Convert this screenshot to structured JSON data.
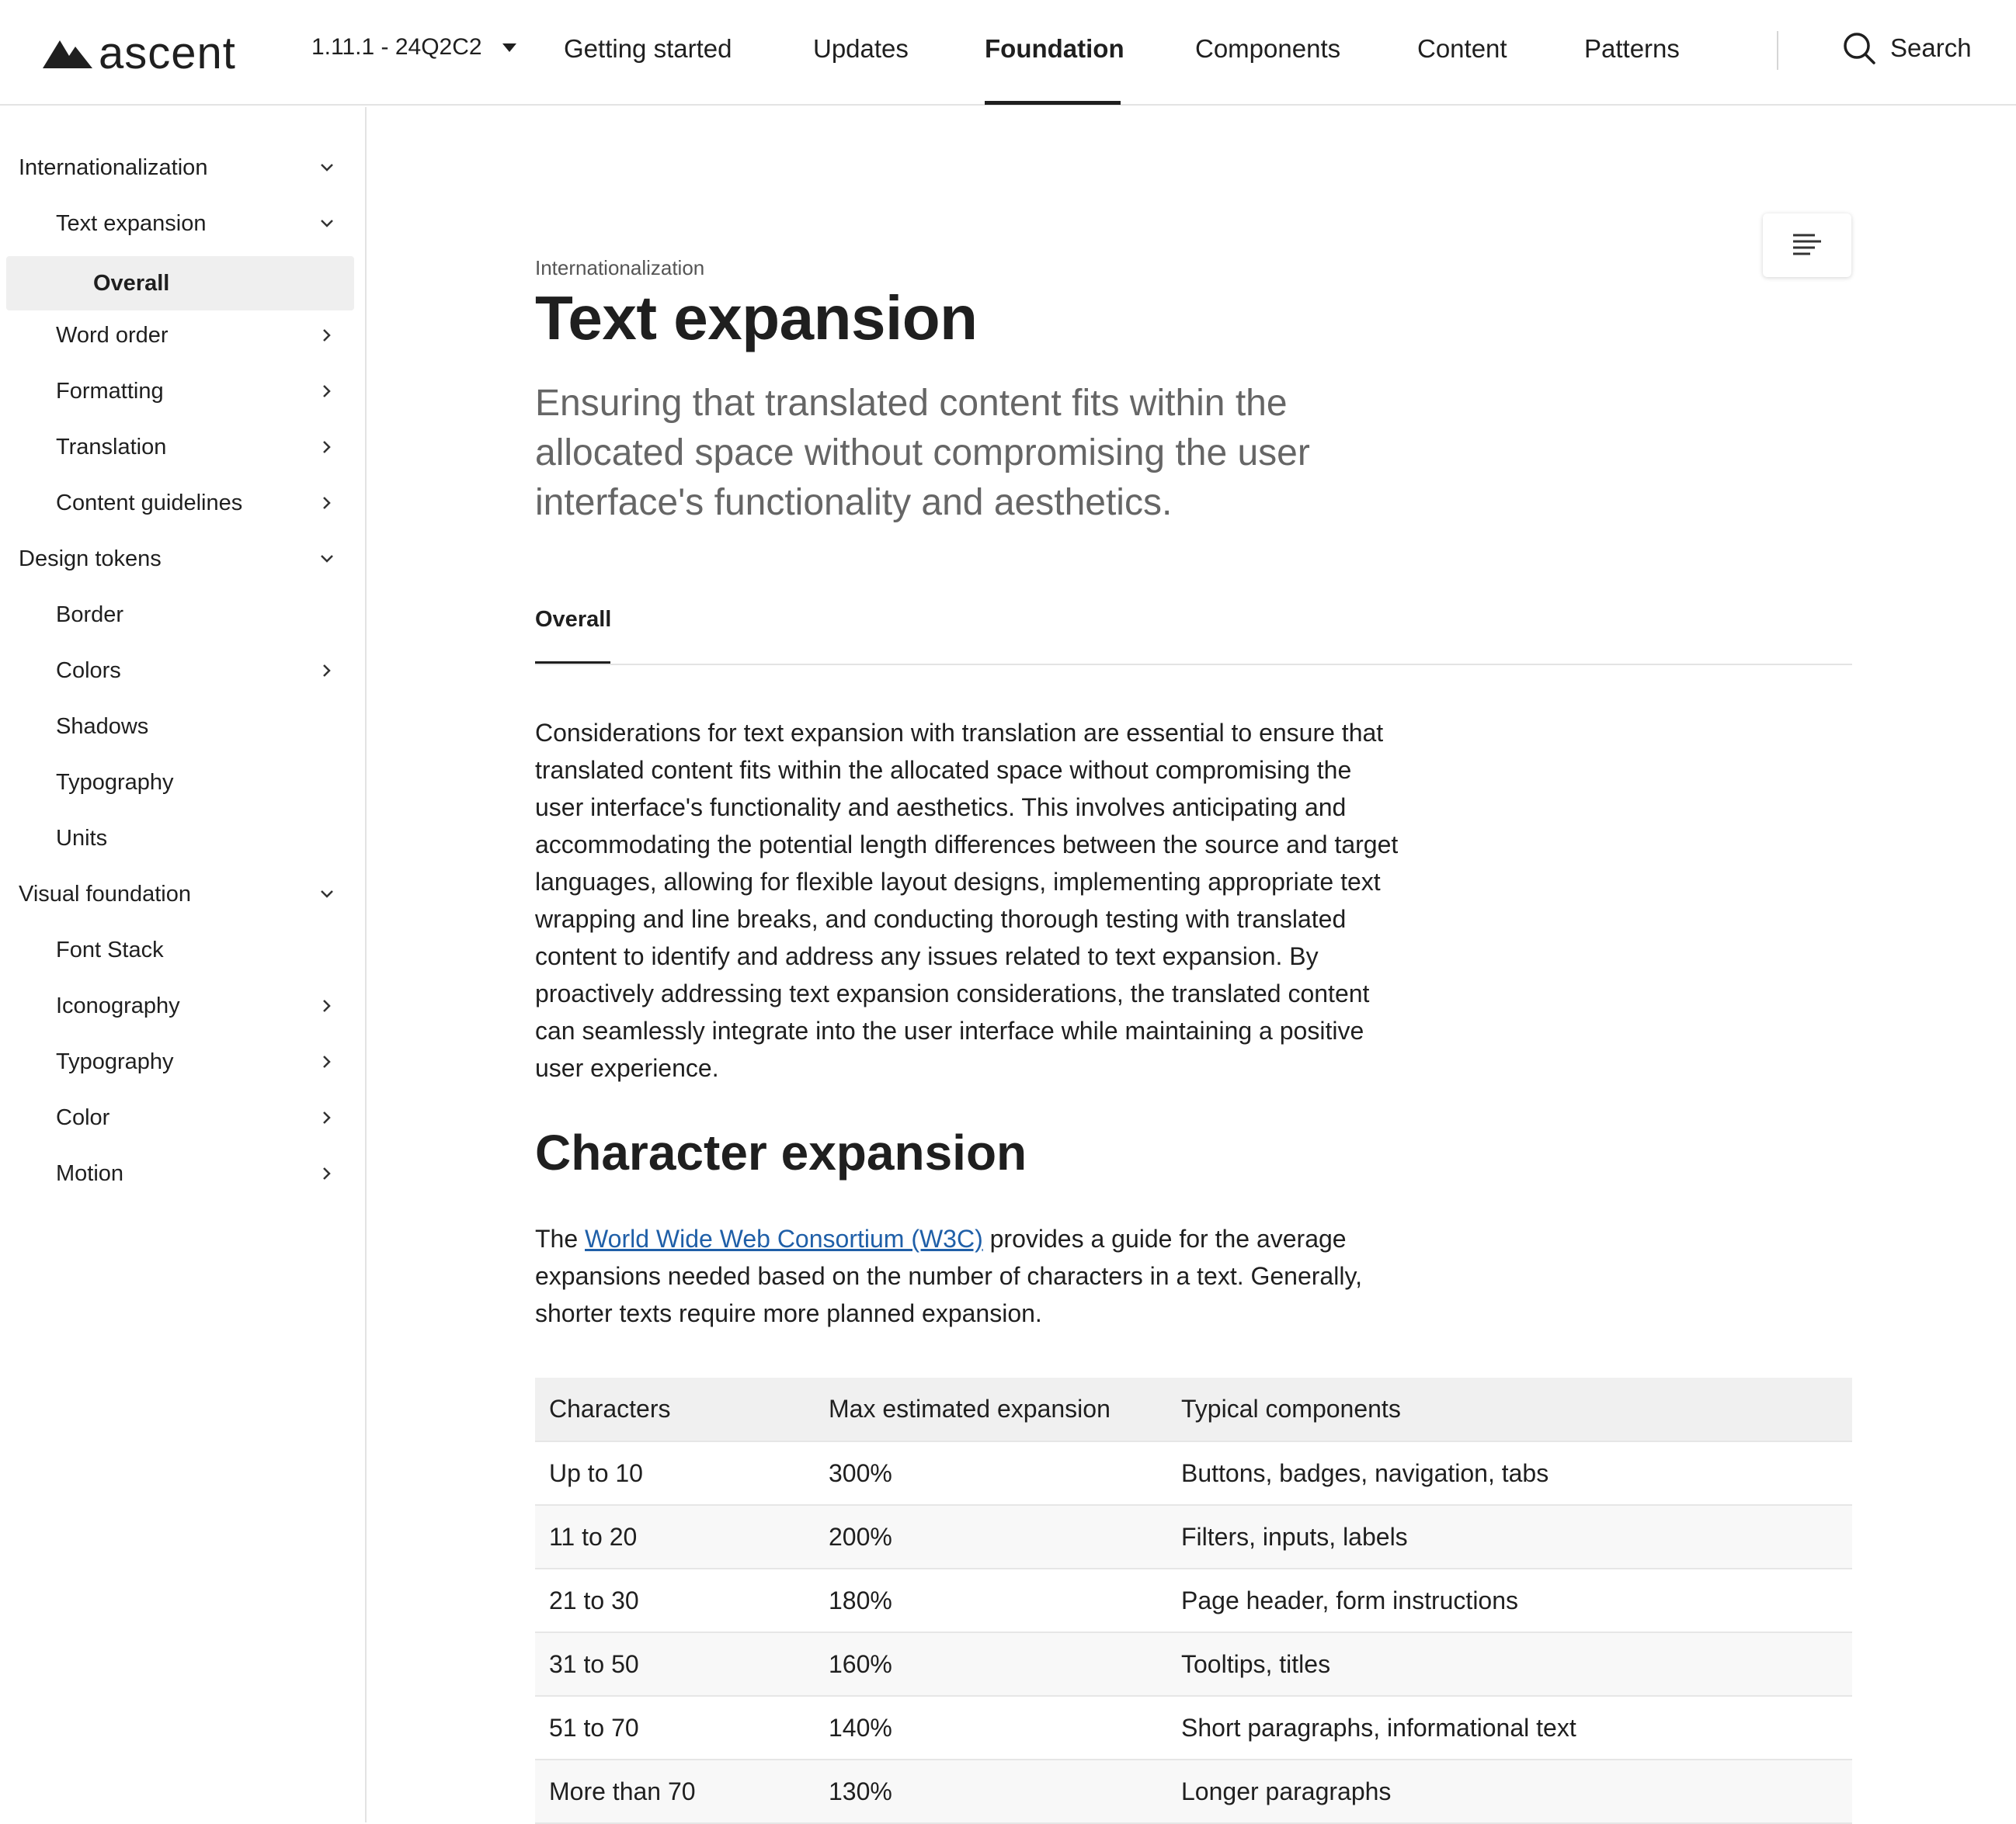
{
  "header": {
    "brand": "ascent",
    "version": "1.11.1 - 24Q2C2",
    "nav": [
      {
        "label": "Getting started",
        "active": false
      },
      {
        "label": "Updates",
        "active": false
      },
      {
        "label": "Foundation",
        "active": true
      },
      {
        "label": "Components",
        "active": false
      },
      {
        "label": "Content",
        "active": false
      },
      {
        "label": "Patterns",
        "active": false
      }
    ],
    "search_label": "Search"
  },
  "sidebar": {
    "items": [
      {
        "label": "Internationalization",
        "level": 1,
        "chevron": "down"
      },
      {
        "label": "Text expansion",
        "level": 2,
        "chevron": "down"
      },
      {
        "label": "Overall",
        "level": 3,
        "chevron": "none",
        "selected": true
      },
      {
        "label": "Word order",
        "level": 2,
        "chevron": "right"
      },
      {
        "label": "Formatting",
        "level": 2,
        "chevron": "right"
      },
      {
        "label": "Translation",
        "level": 2,
        "chevron": "right"
      },
      {
        "label": "Content guidelines",
        "level": 2,
        "chevron": "right"
      },
      {
        "label": "Design tokens",
        "level": 1,
        "chevron": "down"
      },
      {
        "label": "Border",
        "level": 2,
        "chevron": "none"
      },
      {
        "label": "Colors",
        "level": 2,
        "chevron": "right"
      },
      {
        "label": "Shadows",
        "level": 2,
        "chevron": "none"
      },
      {
        "label": "Typography",
        "level": 2,
        "chevron": "none"
      },
      {
        "label": "Units",
        "level": 2,
        "chevron": "none"
      },
      {
        "label": "Visual foundation",
        "level": 1,
        "chevron": "down"
      },
      {
        "label": "Font Stack",
        "level": 2,
        "chevron": "none"
      },
      {
        "label": "Iconography",
        "level": 2,
        "chevron": "right"
      },
      {
        "label": "Typography",
        "level": 2,
        "chevron": "right"
      },
      {
        "label": "Color",
        "level": 2,
        "chevron": "right"
      },
      {
        "label": "Motion",
        "level": 2,
        "chevron": "right"
      }
    ]
  },
  "main": {
    "eyebrow": "Internationalization",
    "title": "Text expansion",
    "lead": "Ensuring that translated content fits within the allocated space without compromising the user interface's functionality and aesthetics.",
    "tab": "Overall",
    "body": "Considerations for text expansion with translation are essential to ensure that translated content fits within the allocated space without compromising the user interface's functionality and aesthetics. This involves anticipating and accommodating the potential length differences between the source and target languages, allowing for flexible layout designs, implementing appropriate text wrapping and line breaks, and conducting thorough testing with translated content to identify and address any issues related to text expansion. By proactively addressing text expansion considerations, the translated content can seamlessly integrate into the user interface while maintaining a positive user experience.",
    "section_title": "Character expansion",
    "intro_before": "The ",
    "intro_link": "World Wide Web Consortium (W3C)",
    "intro_after": " provides a guide for the average expansions needed based on the number of characters in a text. Generally, shorter texts require more planned expansion.",
    "table": {
      "headers": [
        "Characters",
        "Max estimated expansion",
        "Typical components"
      ],
      "rows": [
        [
          "Up to 10",
          "300%",
          "Buttons, badges, navigation, tabs"
        ],
        [
          "11 to 20",
          "200%",
          "Filters, inputs, labels"
        ],
        [
          "21 to 30",
          "180%",
          "Page header, form instructions"
        ],
        [
          "31 to 50",
          "160%",
          "Tooltips, titles"
        ],
        [
          "51 to 70",
          "140%",
          "Short paragraphs, informational text"
        ],
        [
          "More than 70",
          "130%",
          "Longer paragraphs"
        ]
      ]
    }
  }
}
